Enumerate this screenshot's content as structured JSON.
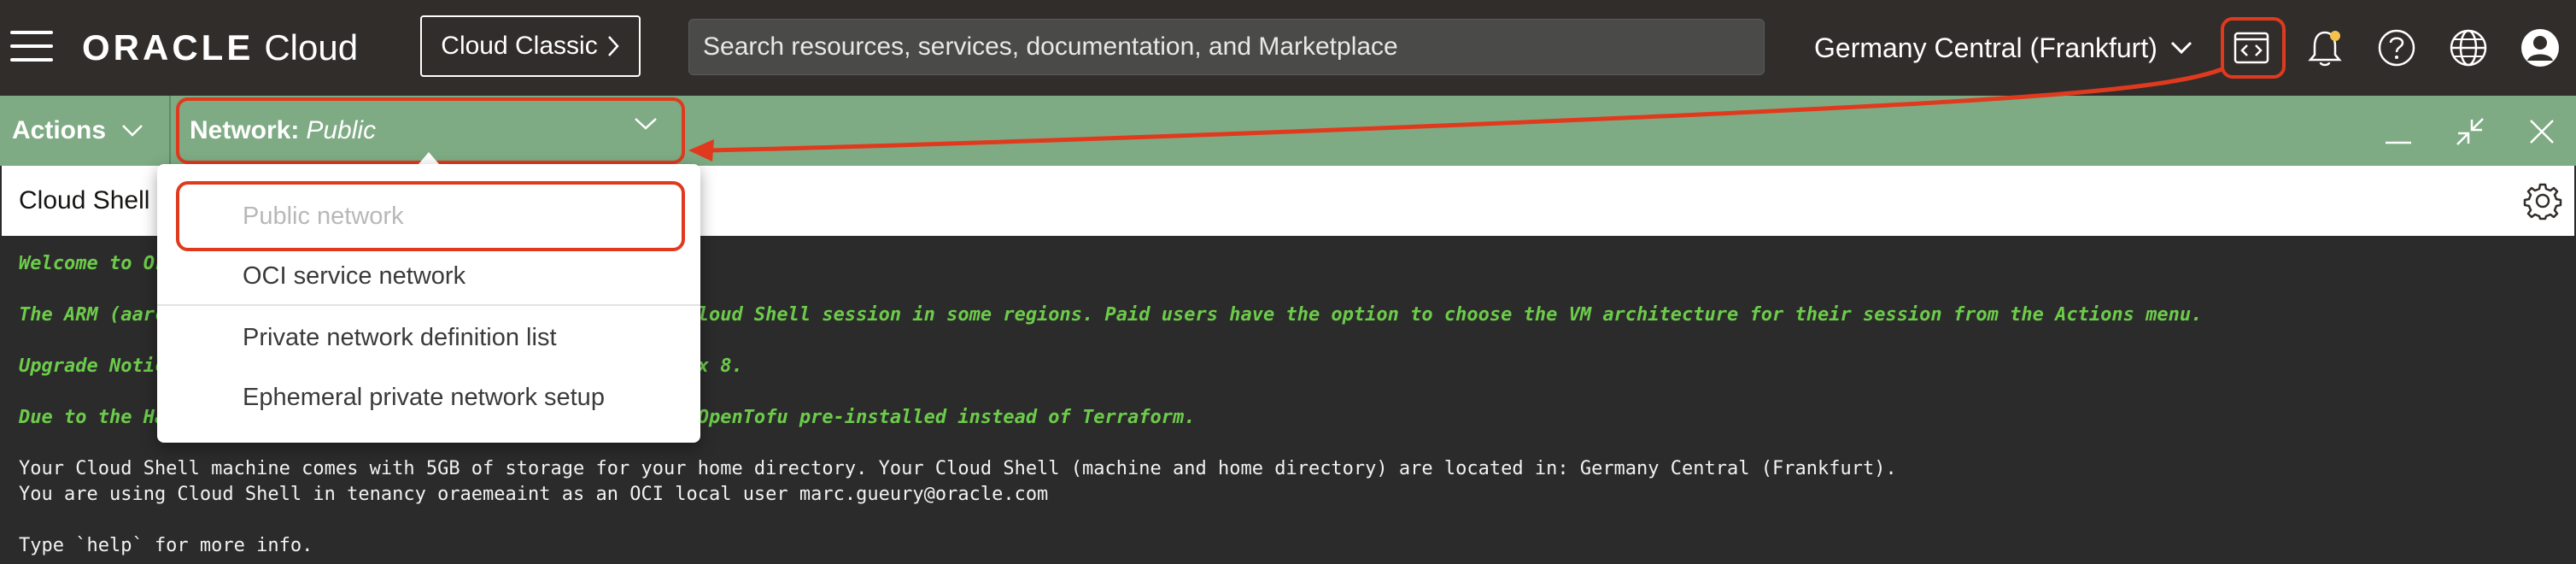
{
  "header": {
    "brand": "ORACLE",
    "product": "Cloud",
    "classic_button": "Cloud Classic",
    "search_placeholder": "Search resources, services, documentation, and Marketplace",
    "region": "Germany Central (Frankfurt)",
    "icons": [
      "menu-icon",
      "code-editor-icon",
      "bell-icon",
      "help-icon",
      "globe-icon",
      "user-icon"
    ]
  },
  "shell_bar": {
    "actions_label": "Actions",
    "network_label": "Network:",
    "network_value": "Public"
  },
  "title_row": {
    "title": "Cloud Shell"
  },
  "network_menu": {
    "items": [
      {
        "label": "Public network",
        "disabled": true
      },
      {
        "label": "OCI service network",
        "disabled": false
      },
      {
        "label": "Private network definition list",
        "disabled": false
      },
      {
        "label": "Ephemeral private network setup",
        "disabled": false
      }
    ]
  },
  "terminal": {
    "lines": [
      "Welcome to Oracle Cloud Shell.",
      "The ARM (aarch64) architecture is now the default for your Cloud Shell session in some regions. Paid users have the option to choose the VM architecture for their session from the Actions menu.",
      "Upgrade Notice: Cloud Shell has been upgraded to Oracle Linux 8.",
      "Due to the Hashicorp licensing change, Cloud Shell now have OpenTofu pre-installed instead of Terraform.",
      "Your Cloud Shell machine comes with 5GB of storage for your home directory. Your Cloud Shell (machine and home directory) are located in: Germany Central (Frankfurt).",
      "You are using Cloud Shell in tenancy oraemeaint as an OCI local user marc.gueury@oracle.com",
      "Type `help` for more info."
    ]
  },
  "colors": {
    "topbar": "#312d2a",
    "shell_bar": "#7eab84",
    "annotation": "#e03a1e",
    "terminal_green": "#6ccc4a"
  }
}
